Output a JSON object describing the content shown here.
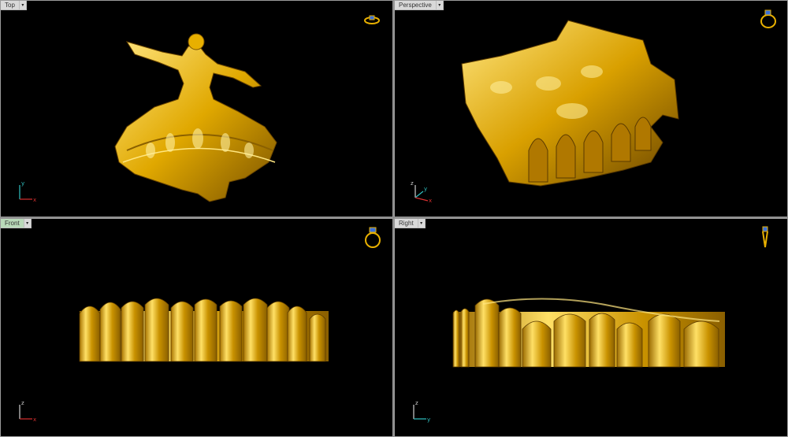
{
  "viewports": {
    "top": {
      "label": "Top",
      "axes": {
        "a": "y",
        "b": "x"
      }
    },
    "persp": {
      "label": "Perspective",
      "axes": {
        "a": "z",
        "b": "y",
        "c": "x"
      }
    },
    "front": {
      "label": "Front",
      "axes": {
        "a": "z",
        "b": "x"
      }
    },
    "right": {
      "label": "Right",
      "axes": {
        "a": "z",
        "b": "y"
      }
    }
  },
  "dropdown_glyph": "▾",
  "colors": {
    "gold_light": "#ffd84a",
    "gold_mid": "#e0a800",
    "gold_dark": "#7a5200",
    "axis_x": "#d83030",
    "axis_y": "#30c0c0",
    "axis_z": "#d0d0d0"
  },
  "icons": [
    "ring-view-icon",
    "axis-gizmo-icon",
    "dropdown-arrow-icon"
  ]
}
